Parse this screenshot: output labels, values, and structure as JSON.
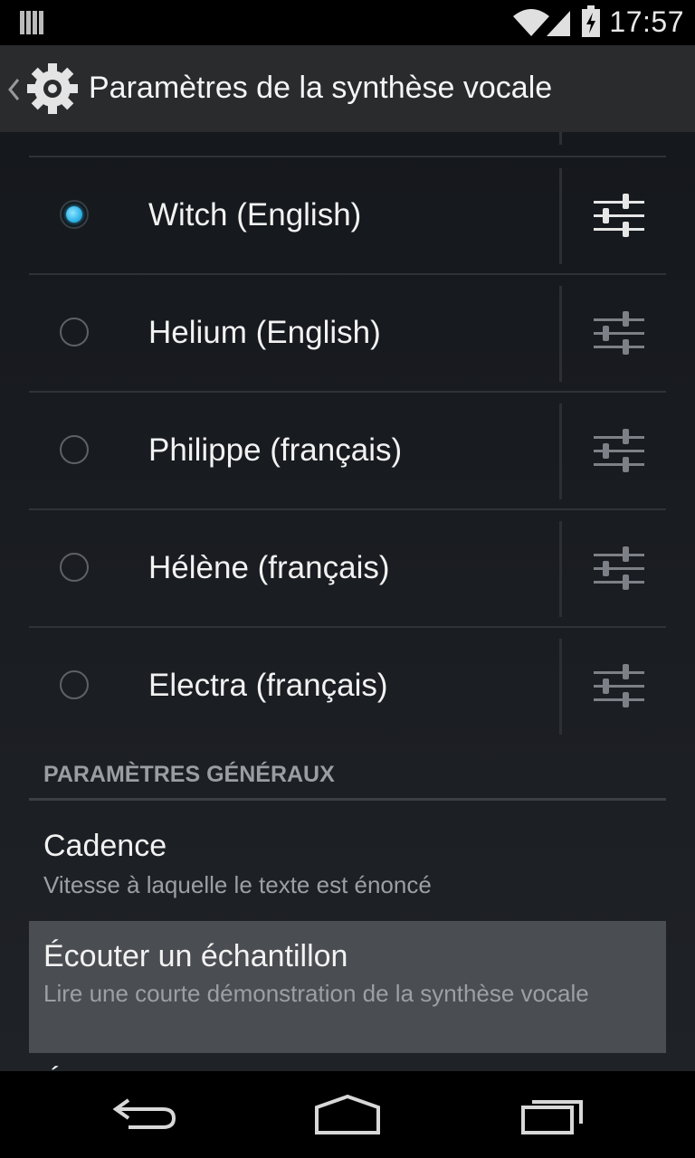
{
  "status_bar": {
    "time": "17:57"
  },
  "action_bar": {
    "title": "Paramètres de la synthèse vocale"
  },
  "engines": [
    {
      "label": "Witch (English)",
      "selected": true
    },
    {
      "label": "Helium (English)",
      "selected": false
    },
    {
      "label": "Philippe (français)",
      "selected": false
    },
    {
      "label": "Hélène (français)",
      "selected": false
    },
    {
      "label": "Electra (français)",
      "selected": false
    }
  ],
  "general": {
    "header": "PARAMÈTRES GÉNÉRAUX",
    "cadence": {
      "title": "Cadence",
      "summary": "Vitesse à laquelle le texte est énoncé"
    },
    "sample": {
      "title": "Écouter un échantillon",
      "summary": "Lire une courte démonstration de la synthèse vocale"
    },
    "next_partial": "É"
  },
  "icons": {
    "back": "back-icon",
    "home": "home-icon",
    "recents": "recents-icon",
    "settings": "gear-icon",
    "sliders": "sliders-icon"
  },
  "colors": {
    "accent": "#33b5e5",
    "highlight": "#4a4d52"
  }
}
